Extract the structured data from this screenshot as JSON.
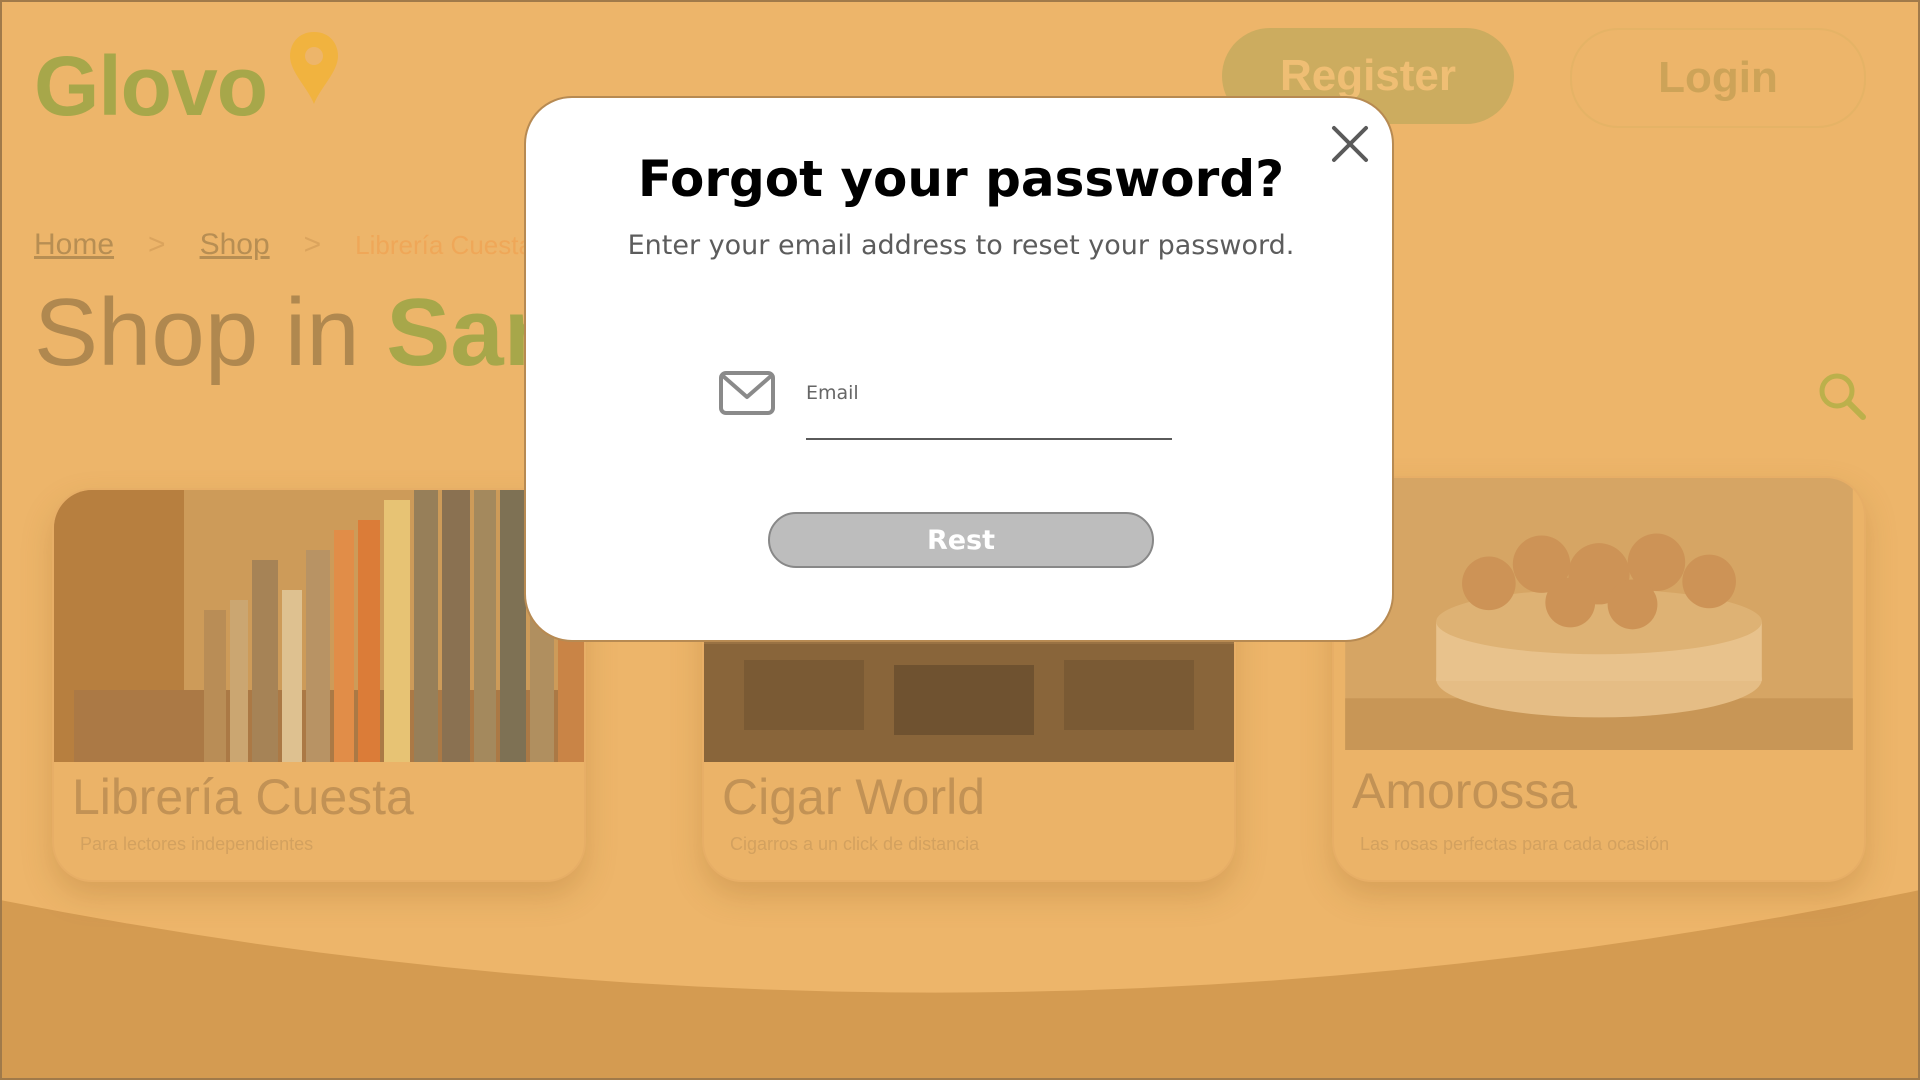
{
  "brand": {
    "logo_text": "Glovo"
  },
  "header": {
    "register_label": "Register",
    "login_label": "Login"
  },
  "breadcrumb": {
    "home": "Home",
    "separator": ">",
    "shop": "Shop",
    "current": "Librería Cuesta"
  },
  "shop_title": {
    "prefix": "Shop in ",
    "highlight": "San"
  },
  "cards": [
    {
      "title": "Librería Cuesta",
      "subtitle": "Para lectores independientes"
    },
    {
      "title": "Cigar World",
      "subtitle": "Cigarros a un click de distancia"
    },
    {
      "title": "Amorossa",
      "subtitle": "Las rosas perfectas para cada ocasión"
    }
  ],
  "modal": {
    "title": "Forgot your password?",
    "subtitle": "Enter your email address to reset your password.",
    "email_label": "Email",
    "email_value": "",
    "submit_label": "Rest"
  },
  "colors": {
    "background_orange": "#edb86f",
    "wave_orange": "#d19a53",
    "brand_green": "#9ea84a",
    "button_gray": "#bdbdbd"
  },
  "icons": [
    "location-pin-icon",
    "search-icon",
    "close-icon",
    "envelope-icon"
  ]
}
